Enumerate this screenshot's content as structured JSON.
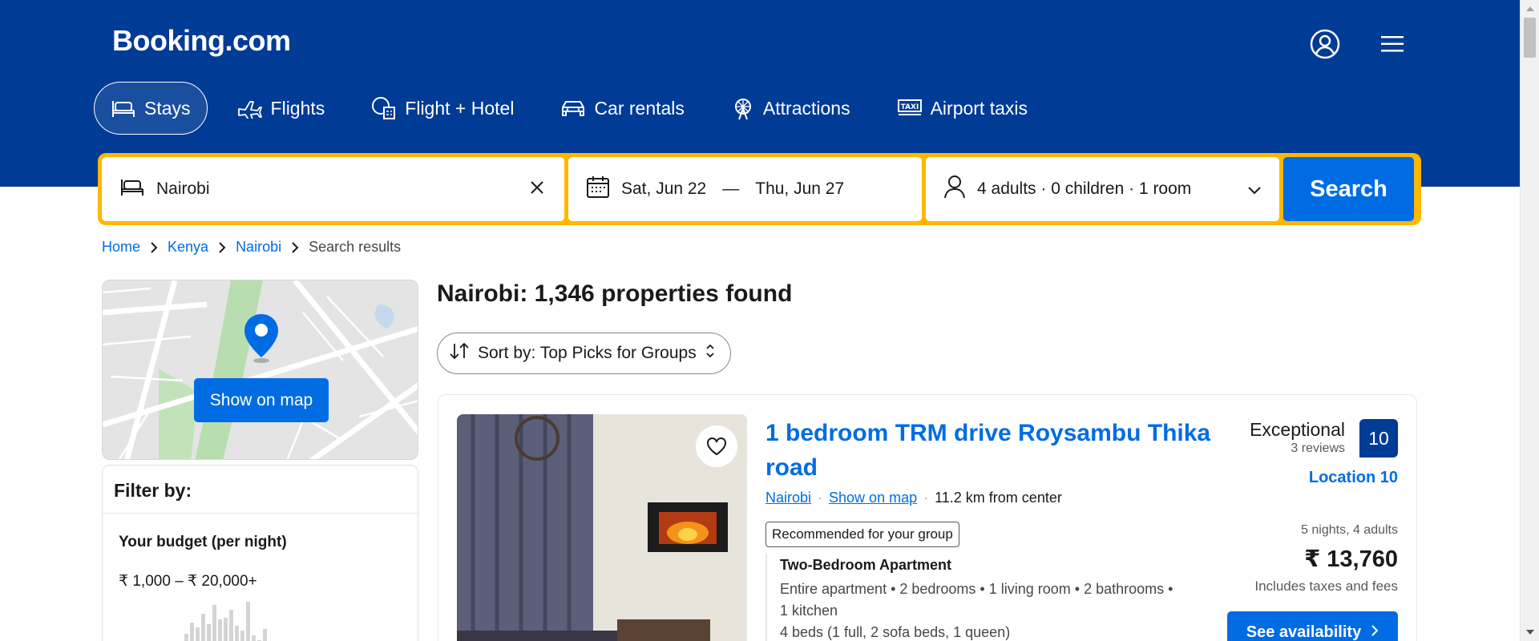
{
  "brand": {
    "logo": "Booking.com"
  },
  "colors": {
    "header_bg": "#003b95",
    "accent": "#006ce4",
    "searchbar_border": "#ffb700",
    "score_bg": "#003b95"
  },
  "header_icons": {
    "account": "user-circle-icon",
    "menu": "hamburger-menu-icon"
  },
  "nav_tabs": [
    {
      "label": "Stays",
      "icon": "bed-icon",
      "active": true
    },
    {
      "label": "Flights",
      "icon": "plane-icon",
      "active": false
    },
    {
      "label": "Flight + Hotel",
      "icon": "flight-hotel-icon",
      "active": false
    },
    {
      "label": "Car rentals",
      "icon": "car-icon",
      "active": false
    },
    {
      "label": "Attractions",
      "icon": "ferris-wheel-icon",
      "active": false
    },
    {
      "label": "Airport taxis",
      "icon": "taxi-icon",
      "active": false
    }
  ],
  "search": {
    "destination": "Nairobi",
    "checkin": "Sat, Jun 22",
    "date_separator": "—",
    "checkout": "Thu, Jun 27",
    "guests": "4 adults · 0 children · 1 room",
    "button": "Search"
  },
  "breadcrumb": [
    {
      "label": "Home",
      "link": true
    },
    {
      "label": "Kenya",
      "link": true
    },
    {
      "label": "Nairobi",
      "link": true
    },
    {
      "label": "Search results",
      "link": false
    }
  ],
  "map": {
    "button": "Show on map"
  },
  "filters": {
    "title": "Filter by:",
    "budget_title": "Your budget (per night)",
    "budget_range": "₹ 1,000 – ₹ 20,000+"
  },
  "results": {
    "title": "Nairobi: 1,346 properties found",
    "sort_label": "Sort by: Top Picks for Groups"
  },
  "listing": {
    "title": "1 bedroom TRM drive Roysambu Thika road",
    "city_link": "Nairobi",
    "map_link": "Show on map",
    "distance": "11.2 km from center",
    "badge": "Recommended for your group",
    "room_name": "Two-Bedroom Apartment",
    "room_desc_1": "Entire apartment • 2 bedrooms • 1 living room • 2 bathrooms •",
    "room_desc_2": "1 kitchen",
    "room_desc_3": "4 beds (1 full, 2 sofa beds, 1 queen)",
    "rating_word": "Exceptional",
    "reviews": "3 reviews",
    "score": "10",
    "location_score": "Location 10",
    "stay_info": "5 nights, 4 adults",
    "price": "₹ 13,760",
    "taxes": "Includes taxes and fees",
    "cta": "See availability"
  }
}
